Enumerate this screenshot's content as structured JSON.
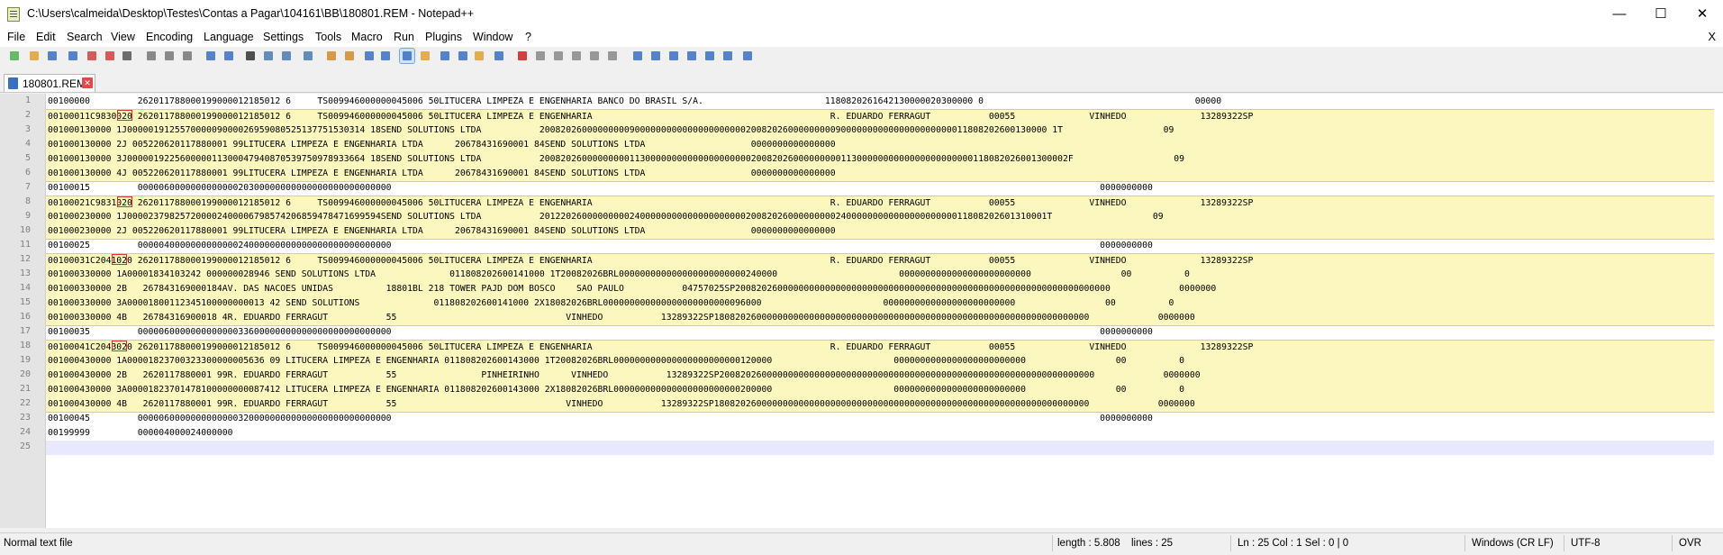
{
  "window": {
    "title": "C:\\Users\\calmeida\\Desktop\\Testes\\Contas a Pagar\\104161\\BB\\180801.REM - Notepad++",
    "minimize": "—",
    "maximize": "☐",
    "close": "✕"
  },
  "menu": {
    "items": [
      "File",
      "Edit",
      "Search",
      "View",
      "Encoding",
      "Language",
      "Settings",
      "Tools",
      "Macro",
      "Run",
      "Plugins",
      "Window",
      "?"
    ],
    "close_doc": "X"
  },
  "toolbar": {
    "icons": [
      "new-file-icon",
      "open-file-icon",
      "save-icon",
      "save-all-icon",
      "close-icon",
      "close-all-icon",
      "print-icon",
      "cut-icon",
      "copy-icon",
      "paste-icon",
      "undo-icon",
      "redo-icon",
      "find-icon",
      "replace-icon",
      "zoom-in-icon",
      "zoom-out-icon",
      "sync-vertical-icon",
      "sync-horizontal-icon",
      "word-wrap-icon",
      "show-all-chars-icon",
      "indent-guide-icon",
      "language-icon",
      "doc-map-icon",
      "function-list-icon",
      "folder-as-workspace-icon",
      "monitor-icon",
      "record-macro-icon",
      "stop-record-icon",
      "play-macro-icon",
      "run-macro-multiple-icon",
      "save-macro-icon",
      "launch-run-icon",
      "toggle-panel-icon",
      "toggle-panel-icon-2",
      "fold-all-icon",
      "prev-bookmark-icon",
      "next-bookmark-icon",
      "unfold-all-icon",
      "panel-icon"
    ]
  },
  "tab": {
    "label": "180801.REM",
    "close": "✕"
  },
  "editor": {
    "lines": [
      {
        "n": "1",
        "text": "00100000         262011788000199000012185012 6     TS009946000000045006 50LITUCERA LIMPEZA E ENGENHARIA BANCO DO BRASIL S/A.                       1180820261642130000020300000 0                                        00000"
      },
      {
        "n": "2",
        "text": "00100011C9830020 262011788000199000012185012 6     TS009946000000045006 50LITUCERA LIMPEZA E ENGENHARIA                                             R. EDUARDO FERRAGUT           00055              VINHEDO              13289322SP"
      },
      {
        "n": "3",
        "text": "001000130000 1J000001912557000009000026959080525137751530314 18SEND SOLUTIONS LTDA           200820260000000009000000000000000000000200820260000000009000000000000000000000011808202600130000 1T                   09"
      },
      {
        "n": "4",
        "text": "001000130000 2J 005220620117880001 99LITUCERA LIMPEZA E ENGENHARIA LTDA      20678431690001 84SEND SOLUTIONS LTDA                    0000000000000000"
      },
      {
        "n": "5",
        "text": "001000130000 3J000001922560000011300047940870539750978933664 18SEND SOLUTIONS LTDA           2008202600000000011300000000000000000000200820260000000001130000000000000000000000118082026001300002F                   09"
      },
      {
        "n": "6",
        "text": "001000130000 4J 005220620117880001 99LITUCERA LIMPEZA E ENGENHARIA LTDA      20678431690001 84SEND SOLUTIONS LTDA                    0000000000000000"
      },
      {
        "n": "7",
        "text": "00100015         000006000000000000020300000000000000000000000000                                                                                                                                      0000000000"
      },
      {
        "n": "8",
        "text": "00100021C9831020 262011788000199000012185012 6     TS009946000000045006 50LITUCERA LIMPEZA E ENGENHARIA                                             R. EDUARDO FERRAGUT           00055              VINHEDO              13289322SP"
      },
      {
        "n": "9",
        "text": "001000230000 1J000023798257200002400006798574206859478471699594SEND SOLUTIONS LTDA           201220260000000002400000000000000000000200820260000000002400000000000000000000011808202601310001T                   09"
      },
      {
        "n": "10",
        "text": "001000230000 2J 005220620117880001 99LITUCERA LIMPEZA E ENGENHARIA LTDA      20678431690001 84SEND SOLUTIONS LTDA                    0000000000000000"
      },
      {
        "n": "11",
        "text": "00100025         000004000000000000024000000000000000000000000000                                                                                                                                      0000000000"
      },
      {
        "n": "12",
        "text": "00100031C2041020 262011788000199000012185012 6     TS009946000000045006 50LITUCERA LIMPEZA E ENGENHARIA                                             R. EDUARDO FERRAGUT           00055              VINHEDO              13289322SP"
      },
      {
        "n": "13",
        "text": "001000330000 1A00001834103242 000000028946 SEND SOLUTIONS LTDA              011808202600141000 1T20082026BRL000000000000000000000000240000                       0000000000000000000000000                 00          0"
      },
      {
        "n": "14",
        "text": "001000330000 2B   267843169000184AV. DAS NACOES UNIDAS          18801BL 218 TOWER PAJD DOM BOSCO    SAO PAULO           04757025SP20082026000000000000000000000000000000000000000000000000000000000000000             0000000"
      },
      {
        "n": "15",
        "text": "001000330000 3A00001800112345100000000013 42 SEND SOLUTIONS              011808202600141000 2X18082026BRL000000000000000000000000096000                       0000000000000000000000000                 00          0"
      },
      {
        "n": "16",
        "text": "001000330000 4B   26784316900018 4R. EDUARDO FERRAGUT           55                                VINHEDO           13289322SP18082026000000000000000000000000000000000000000000000000000000000000000             0000000"
      },
      {
        "n": "17",
        "text": "00100035         000006000000000000033600000000000000000000000000                                                                                                                                      0000000000"
      },
      {
        "n": "18",
        "text": "00100041C2043020 262011788000199000012185012 6     TS009946000000045006 50LITUCERA LIMPEZA E ENGENHARIA                                             R. EDUARDO FERRAGUT           00055              VINHEDO              13289322SP"
      },
      {
        "n": "19",
        "text": "001000430000 1A00001823700323300000005636 09 LITUCERA LIMPEZA E ENGENHARIA 011808202600143000 1T20082026BRL000000000000000000000000120000                       0000000000000000000000000                 00          0"
      },
      {
        "n": "20",
        "text": "001000430000 2B   2620117880001 99R. EDUARDO FERRAGUT           55                PINHEIRINHO      VINHEDO           13289322SP20082026000000000000000000000000000000000000000000000000000000000000000             0000000"
      },
      {
        "n": "21",
        "text": "001000430000 3A00001823701478100000000087412 LITUCERA LIMPEZA E ENGENHARIA 011808202600143000 2X18082026BRL000000000000000000000000200000                       0000000000000000000000000                 00          0"
      },
      {
        "n": "22",
        "text": "001000430000 4B   2620117880001 99R. EDUARDO FERRAGUT           55                                VINHEDO           13289322SP18082026000000000000000000000000000000000000000000000000000000000000000             0000000"
      },
      {
        "n": "23",
        "text": "00100045         000006000000000000032000000000000000000000000000                                                                                                                                      0000000000"
      },
      {
        "n": "24",
        "text": "00199999         000004000024000000"
      },
      {
        "n": "25",
        "text": ""
      }
    ]
  },
  "status": {
    "doc_type": "Normal text file",
    "length": "length : 5.808",
    "lines": "lines : 25",
    "position": "Ln : 25    Col : 1    Sel : 0 | 0",
    "eol": "Windows (CR LF)",
    "encoding": "UTF-8",
    "mode": "OVR"
  }
}
